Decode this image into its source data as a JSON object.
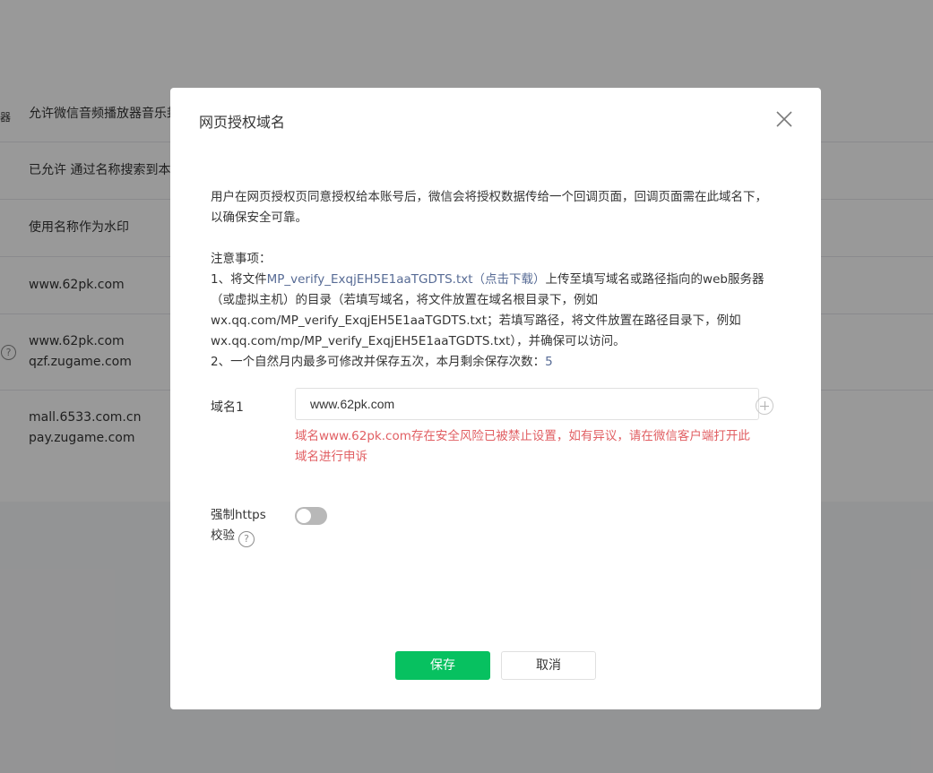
{
  "background": {
    "edge_glyph": "器",
    "rows": [
      {
        "lines": [
          "允许微信音频播放器音乐封面"
        ]
      },
      {
        "lines": [
          "已允许 通过名称搜索到本帐号"
        ]
      },
      {
        "lines": [
          "使用名称作为水印"
        ]
      },
      {
        "lines": [
          "www.62pk.com"
        ]
      },
      {
        "lines": [
          "www.62pk.com",
          "qzf.zugame.com"
        ]
      },
      {
        "lines": [
          "mall.6533.com.cn",
          "pay.zugame.com"
        ]
      }
    ]
  },
  "dialog": {
    "title": "网页授权域名",
    "description": "用户在网页授权页同意授权给本账号后，微信会将授权数据传给一个回调页面，回调页面需在此域名下，以确保安全可靠。",
    "notes_title": "注意事项：",
    "note1_prefix": "1、将文件",
    "note1_link": "MP_verify_ExqjEH5E1aaTGDTS.txt（点击下载）",
    "note1_suffix": "上传至填写域名或路径指向的web服务器（或虚拟主机）的目录（若填写域名，将文件放置在域名根目录下，例如wx.qq.com/MP_verify_ExqjEH5E1aaTGDTS.txt；若填写路径，将文件放置在路径目录下，例如wx.qq.com/mp/MP_verify_ExqjEH5E1aaTGDTS.txt），并确保可以访问。",
    "note2_prefix": "2、一个自然月内最多可修改并保存五次，本月剩余保存次数：",
    "note2_count": "5",
    "domain_label": "域名1",
    "domain_value": "www.62pk.com",
    "error_message": "域名www.62pk.com存在安全风险已被禁止设置，如有异议，请在微信客户端打开此域名进行申诉",
    "https_label_line1": "强制https",
    "https_label_line2": "校验",
    "https_enabled": false,
    "save_label": "保存",
    "cancel_label": "取消"
  },
  "colors": {
    "primary": "#07c160",
    "link": "#576b95",
    "error": "#e15f63",
    "overlay": "rgba(0,0,0,0.4)"
  },
  "icons": {
    "close": "close-icon",
    "help": "question-circle-icon",
    "add": "plus-circle-icon"
  }
}
